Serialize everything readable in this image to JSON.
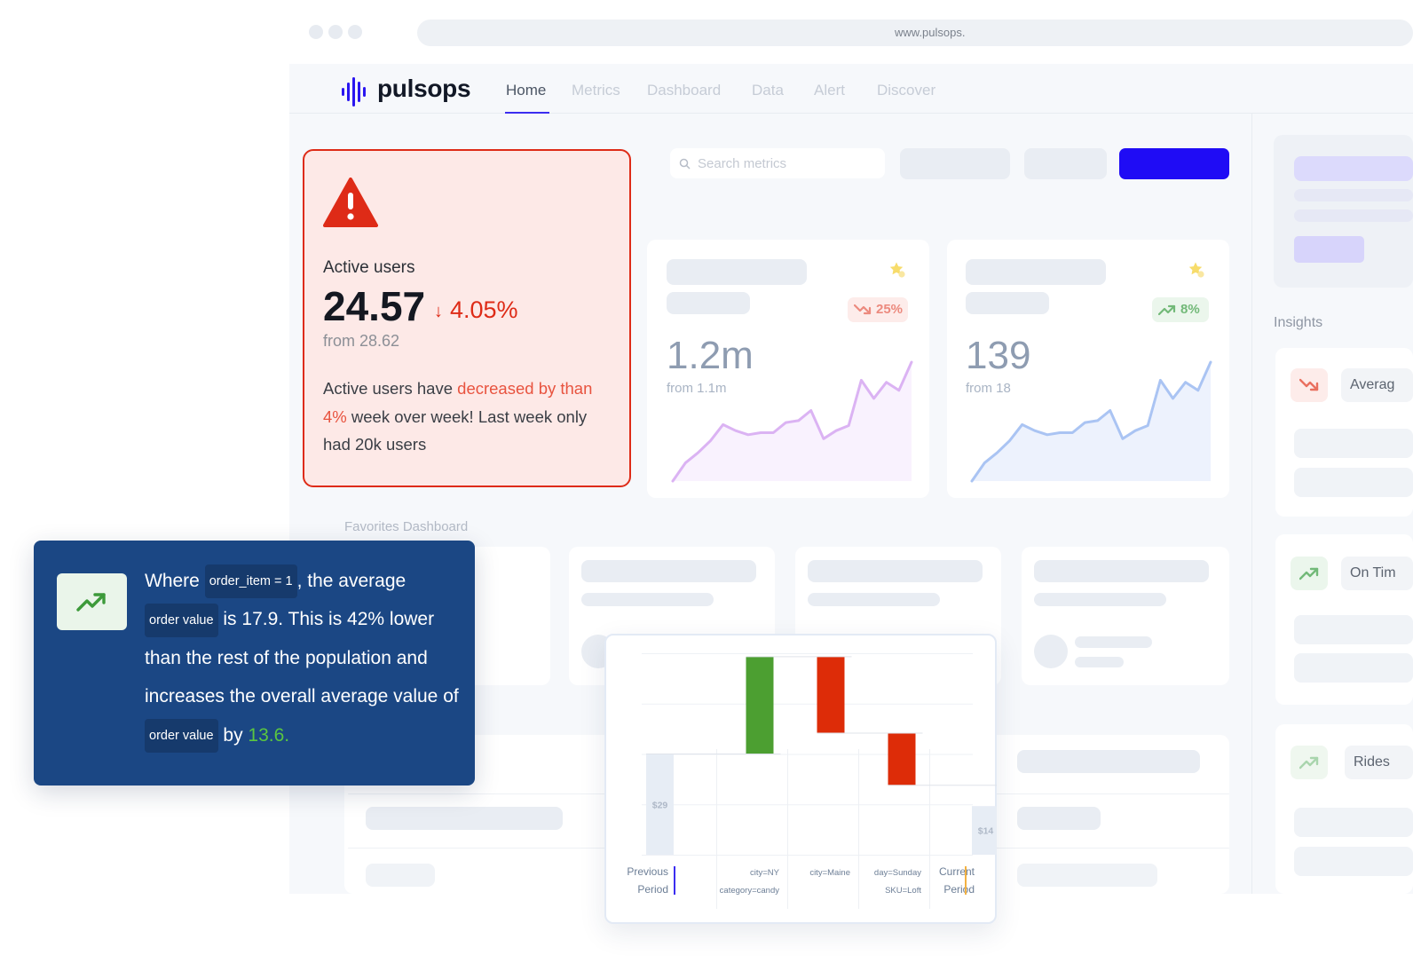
{
  "browser": {
    "url": "www.pulsops."
  },
  "app": {
    "name": "pulsops",
    "nav": [
      {
        "label": "Home",
        "active": true
      },
      {
        "label": "Metrics"
      },
      {
        "label": "Dashboard"
      },
      {
        "label": "Data"
      },
      {
        "label": "Alert"
      },
      {
        "label": "Discover"
      }
    ],
    "accent_color": "#1f0cf5"
  },
  "search": {
    "placeholder": "Search metrics"
  },
  "alert_card": {
    "label": "Active users",
    "value": "24.57",
    "delta": "4.05%",
    "from": "from 28.62",
    "desc_pre": "Active users have ",
    "desc_hl": "decreased by than 4%",
    "desc_post": " week over week! Last week only had 20k users",
    "color": "#de2b17"
  },
  "metric_cards": [
    {
      "value": "1.2m",
      "from": "from 1.1m",
      "badge": "25%",
      "trend": "down",
      "series": [
        0,
        18,
        28,
        40,
        56,
        50,
        46,
        48,
        48,
        58,
        60,
        70,
        42,
        50,
        55,
        100,
        82,
        98,
        90,
        118
      ]
    },
    {
      "value": "139",
      "from": "from 18",
      "badge": "8%",
      "trend": "up",
      "series": [
        0,
        18,
        28,
        40,
        56,
        50,
        46,
        48,
        48,
        58,
        60,
        70,
        42,
        50,
        55,
        100,
        82,
        98,
        90,
        118
      ]
    }
  ],
  "favorites": {
    "label": "Favorites Dashboard"
  },
  "insights": {
    "label": "Insights",
    "items": [
      {
        "label": "Averag",
        "trend": "down"
      },
      {
        "label": "On Tim",
        "trend": "up"
      },
      {
        "label": "Rides",
        "trend": "up"
      }
    ]
  },
  "insight_box": {
    "w1": "Where",
    "tag1": "order_item = 1",
    "w2": ", the average",
    "tag2": "order value",
    "w3": "is 17.9. This is 42% lower than the rest of the population and increases the overall average value of",
    "tag3": "order value",
    "w4": "by",
    "value": "13.6."
  },
  "chart_data": {
    "type": "waterfall",
    "categories": [
      "Previous Period",
      "city=NY category=candy",
      "city=Maine",
      "day=Sunday SKU=Loft",
      "Current Period"
    ],
    "labels": [
      [
        "Previous",
        "Period"
      ],
      [
        "city=NY",
        "category=candy"
      ],
      [
        "city=Maine",
        ""
      ],
      [
        "day=Sunday",
        "SKU=Loft"
      ],
      [
        "Current",
        "Period"
      ]
    ],
    "values": [
      29,
      28,
      -22,
      -15,
      14
    ],
    "bar_labels": [
      "$29",
      "",
      "",
      "",
      "$14"
    ],
    "colors": {
      "total": "#e7edf5",
      "increase": "#4c9f31",
      "decrease": "#dd2c08"
    },
    "ylim": [
      0,
      58
    ]
  }
}
